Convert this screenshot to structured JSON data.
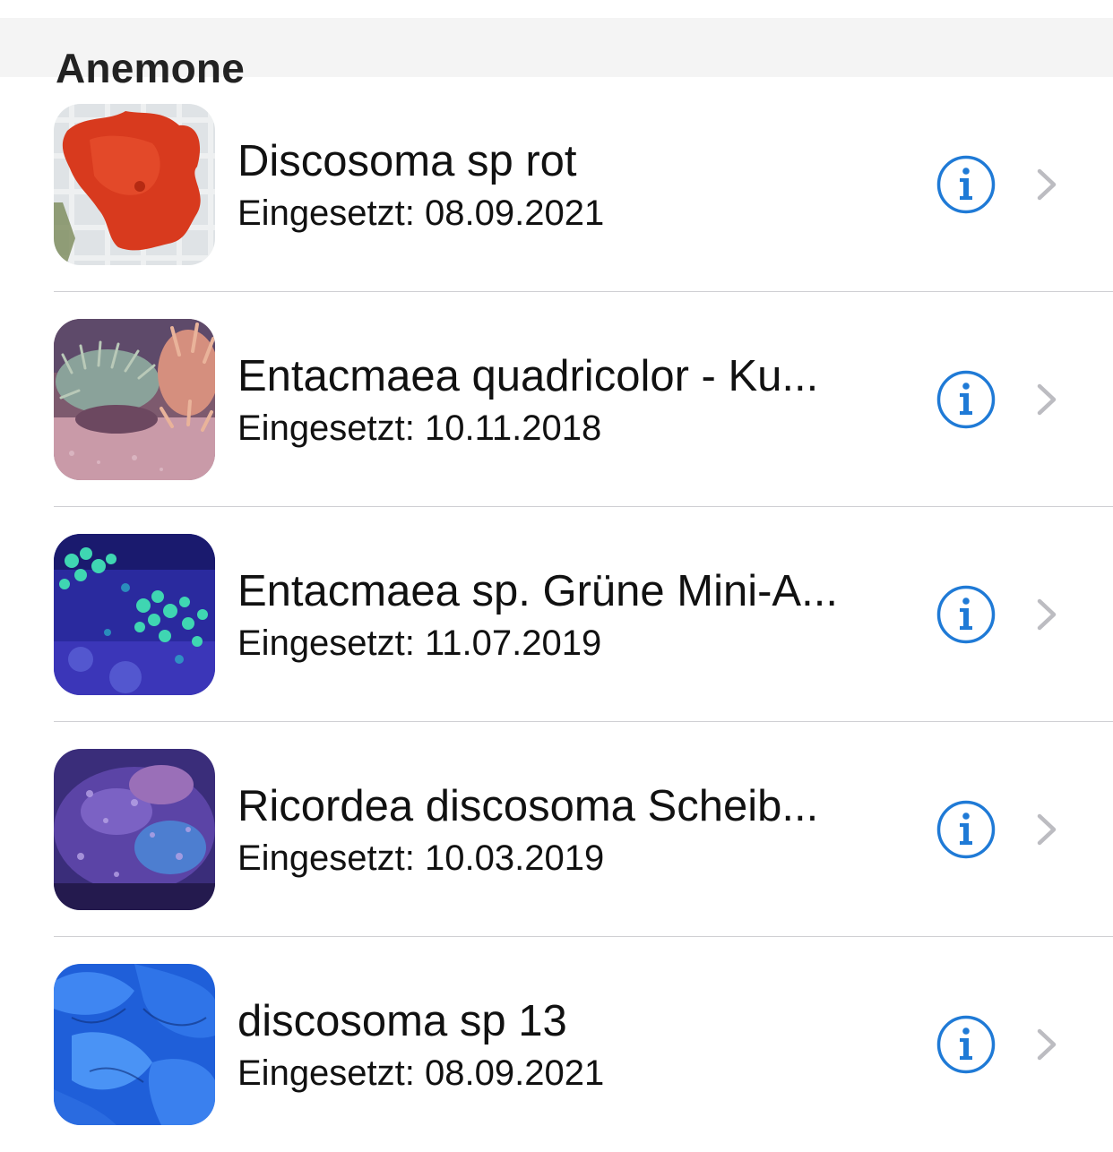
{
  "section": {
    "title": "Anemone"
  },
  "colors": {
    "accent": "#1f7ad6",
    "chevron": "#bcbcc1",
    "separator": "#cfcfd3",
    "header_bg": "#f4f4f4"
  },
  "items": [
    {
      "name": "Discosoma sp rot",
      "subtitle": "Eingesetzt: 08.09.2021",
      "thumbnail": "red-mushroom-coral-photo",
      "info_icon": "info-icon",
      "disclosure_icon": "chevron-right-icon"
    },
    {
      "name": "Entacmaea quadricolor - Ku...",
      "subtitle": "Eingesetzt: 10.11.2018",
      "thumbnail": "pink-bubble-tip-anemone-photo",
      "info_icon": "info-icon",
      "disclosure_icon": "chevron-right-icon"
    },
    {
      "name": "Entacmaea sp. Grüne Mini-A...",
      "subtitle": "Eingesetzt: 11.07.2019",
      "thumbnail": "green-mini-anemone-photo",
      "info_icon": "info-icon",
      "disclosure_icon": "chevron-right-icon"
    },
    {
      "name": "Ricordea discosoma Scheib...",
      "subtitle": "Eingesetzt: 10.03.2019",
      "thumbnail": "purple-ricordea-photo",
      "info_icon": "info-icon",
      "disclosure_icon": "chevron-right-icon"
    },
    {
      "name": "discosoma sp 13",
      "subtitle": "Eingesetzt: 08.09.2021",
      "thumbnail": "blue-discosoma-photo",
      "info_icon": "info-icon",
      "disclosure_icon": "chevron-right-icon"
    }
  ]
}
